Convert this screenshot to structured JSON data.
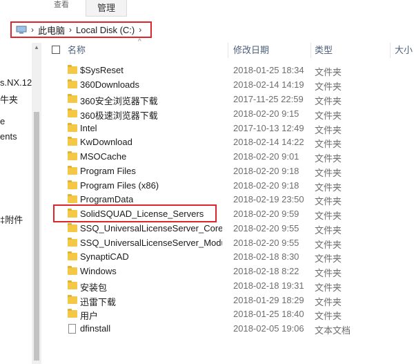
{
  "ribbon": {
    "share_tab": "查看",
    "manage_tab": "管理"
  },
  "address": {
    "root": "此电脑",
    "drive": "Local Disk (C:)",
    "separator": "›",
    "chevron": "›"
  },
  "nav_items": [
    "s.NX.12.",
    "牛夹",
    "e",
    "ents",
    "",
    "",
    "‡附件"
  ],
  "columns": {
    "name": "名称",
    "date": "修改日期",
    "type": "类型",
    "size": "大小"
  },
  "files": [
    {
      "name": "$SysReset",
      "date": "2018-01-25 18:34",
      "type": "文件夹",
      "kind": "folder"
    },
    {
      "name": "360Downloads",
      "date": "2018-02-14 14:19",
      "type": "文件夹",
      "kind": "folder"
    },
    {
      "name": "360安全浏览器下载",
      "date": "2017-11-25 22:59",
      "type": "文件夹",
      "kind": "folder"
    },
    {
      "name": "360极速浏览器下载",
      "date": "2018-02-20 9:15",
      "type": "文件夹",
      "kind": "folder"
    },
    {
      "name": "Intel",
      "date": "2017-10-13 12:49",
      "type": "文件夹",
      "kind": "folder"
    },
    {
      "name": "KwDownload",
      "date": "2018-02-14 14:22",
      "type": "文件夹",
      "kind": "folder"
    },
    {
      "name": "MSOCache",
      "date": "2018-02-20 9:01",
      "type": "文件夹",
      "kind": "folder"
    },
    {
      "name": "Program Files",
      "date": "2018-02-20 9:18",
      "type": "文件夹",
      "kind": "folder"
    },
    {
      "name": "Program Files (x86)",
      "date": "2018-02-20 9:18",
      "type": "文件夹",
      "kind": "folder"
    },
    {
      "name": "ProgramData",
      "date": "2018-02-19 23:50",
      "type": "文件夹",
      "kind": "folder"
    },
    {
      "name": "SolidSQUAD_License_Servers",
      "date": "2018-02-20 9:59",
      "type": "文件夹",
      "kind": "folder"
    },
    {
      "name": "SSQ_UniversalLicenseServer_Core_...",
      "date": "2018-02-20 9:55",
      "type": "文件夹",
      "kind": "folder"
    },
    {
      "name": "SSQ_UniversalLicenseServer_Modu...",
      "date": "2018-02-20 9:55",
      "type": "文件夹",
      "kind": "folder"
    },
    {
      "name": "SynaptiCAD",
      "date": "2018-02-18 8:30",
      "type": "文件夹",
      "kind": "folder"
    },
    {
      "name": "Windows",
      "date": "2018-02-18 8:22",
      "type": "文件夹",
      "kind": "folder"
    },
    {
      "name": "安装包",
      "date": "2018-02-18 19:31",
      "type": "文件夹",
      "kind": "folder"
    },
    {
      "name": "迅雷下载",
      "date": "2018-01-29 18:29",
      "type": "文件夹",
      "kind": "folder"
    },
    {
      "name": "用户",
      "date": "2018-01-25 18:40",
      "type": "文件夹",
      "kind": "folder"
    },
    {
      "name": "dfinstall",
      "date": "2018-02-05 19:06",
      "type": "文本文档",
      "kind": "file"
    }
  ],
  "colors": {
    "highlight": "#e0242c",
    "folder": "#f4c744",
    "header_text": "#4c607a"
  }
}
